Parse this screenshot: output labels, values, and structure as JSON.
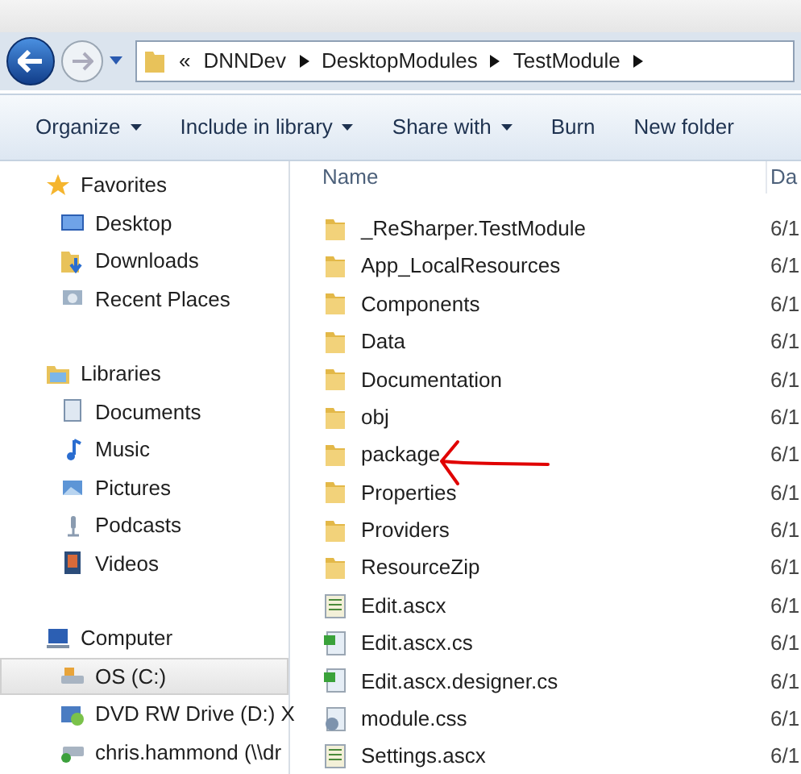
{
  "address_bar": {
    "overflow": "«",
    "segments": [
      "DNNDev",
      "DesktopModules",
      "TestModule"
    ]
  },
  "toolbar": [
    {
      "label": "Organize",
      "dropdown": true
    },
    {
      "label": "Include in library",
      "dropdown": true
    },
    {
      "label": "Share with",
      "dropdown": true
    },
    {
      "label": "Burn",
      "dropdown": false
    },
    {
      "label": "New folder",
      "dropdown": false
    }
  ],
  "sidebar": [
    {
      "label": "Favorites",
      "kind": "favorites",
      "children": [
        {
          "label": "Desktop",
          "kind": "desktop",
          "selected": false
        },
        {
          "label": "Downloads",
          "kind": "downloads",
          "selected": false
        },
        {
          "label": "Recent Places",
          "kind": "recent",
          "selected": false
        }
      ]
    },
    {
      "label": "Libraries",
      "kind": "libraries",
      "children": [
        {
          "label": "Documents",
          "kind": "documents",
          "selected": false
        },
        {
          "label": "Music",
          "kind": "music",
          "selected": false
        },
        {
          "label": "Pictures",
          "kind": "pictures",
          "selected": false
        },
        {
          "label": "Podcasts",
          "kind": "podcasts",
          "selected": false
        },
        {
          "label": "Videos",
          "kind": "videos",
          "selected": false
        }
      ]
    },
    {
      "label": "Computer",
      "kind": "computer",
      "children": [
        {
          "label": "OS (C:)",
          "kind": "drive",
          "selected": true
        },
        {
          "label": "DVD RW Drive (D:) X",
          "kind": "dvd",
          "selected": false
        },
        {
          "label": "chris.hammond (\\\\dr",
          "kind": "network",
          "selected": false
        }
      ]
    }
  ],
  "file_list": {
    "columns": [
      "Name",
      "Da"
    ],
    "rows": [
      {
        "name": "_ReSharper.TestModule",
        "kind": "folder",
        "date": "6/1"
      },
      {
        "name": "App_LocalResources",
        "kind": "folder",
        "date": "6/1"
      },
      {
        "name": "Components",
        "kind": "folder",
        "date": "6/1"
      },
      {
        "name": "Data",
        "kind": "folder",
        "date": "6/1"
      },
      {
        "name": "Documentation",
        "kind": "folder",
        "date": "6/1"
      },
      {
        "name": "obj",
        "kind": "folder",
        "date": "6/1"
      },
      {
        "name": "package",
        "kind": "folder",
        "date": "6/1"
      },
      {
        "name": "Properties",
        "kind": "folder",
        "date": "6/1"
      },
      {
        "name": "Providers",
        "kind": "folder",
        "date": "6/1"
      },
      {
        "name": "ResourceZip",
        "kind": "folder",
        "date": "6/1"
      },
      {
        "name": "Edit.ascx",
        "kind": "ascx",
        "date": "6/1"
      },
      {
        "name": "Edit.ascx.cs",
        "kind": "cs",
        "date": "6/1"
      },
      {
        "name": "Edit.ascx.designer.cs",
        "kind": "cs",
        "date": "6/1"
      },
      {
        "name": "module.css",
        "kind": "css",
        "date": "6/1"
      },
      {
        "name": "Settings.ascx",
        "kind": "ascx",
        "date": "6/1"
      }
    ]
  }
}
